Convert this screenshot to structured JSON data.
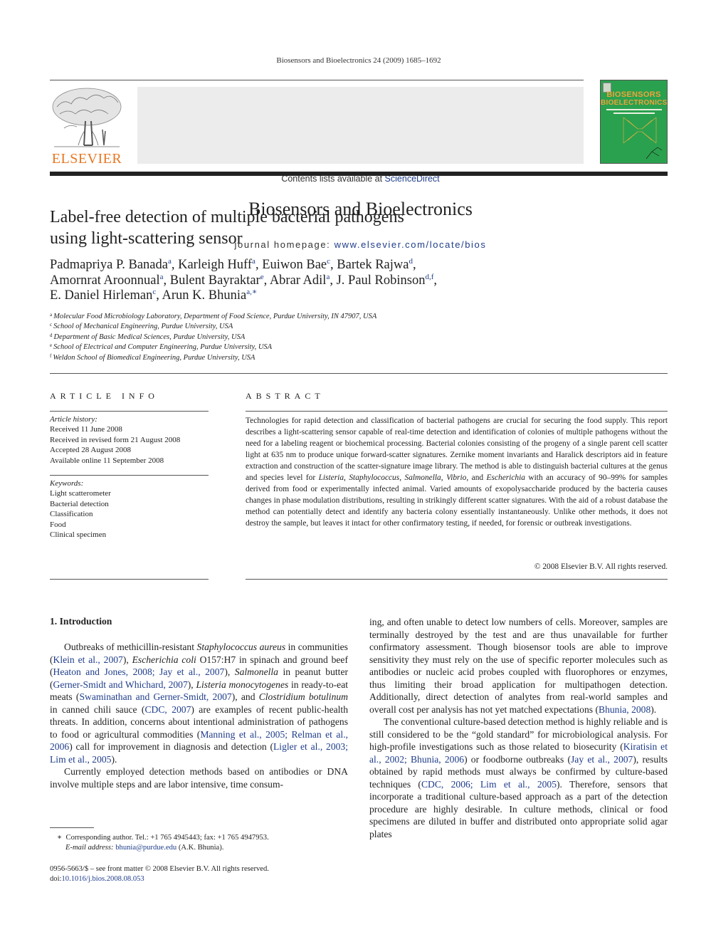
{
  "running_head": "Biosensors and Bioelectronics 24 (2009) 1685–1692",
  "banner": {
    "contents_prefix": "Contents lists available at ",
    "contents_link": "ScienceDirect",
    "journal_title": "Biosensors and Bioelectronics",
    "homepage_prefix": "journal homepage: ",
    "homepage_link": "www.elsevier.com/locate/bios"
  },
  "publisher": {
    "name": "ELSEVIER",
    "logo_color": "#e87722"
  },
  "cover": {
    "line1": "BIOSENSORS",
    "line2": "BIOELECTRONICS",
    "bg_color": "#2aa14e",
    "title_color": "#f0a23a"
  },
  "article": {
    "title_line1": "Label-free detection of multiple bacterial pathogens",
    "title_line2": "using light-scattering sensor",
    "authors": [
      {
        "name": "Padmapriya P. Banada",
        "aff": "a"
      },
      {
        "name": "Karleigh Huff",
        "aff": "a"
      },
      {
        "name": "Euiwon Bae",
        "aff": "c"
      },
      {
        "name": "Bartek Rajwa",
        "aff": "d"
      },
      {
        "name": "Amornrat Aroonnual",
        "aff": "a"
      },
      {
        "name": "Bulent Bayraktar",
        "aff": "e"
      },
      {
        "name": "Abrar Adil",
        "aff": "a"
      },
      {
        "name": "J. Paul Robinson",
        "aff": "d,f"
      },
      {
        "name": "E. Daniel Hirleman",
        "aff": "c"
      },
      {
        "name": "Arun K. Bhunia",
        "aff": "a,∗"
      }
    ],
    "affiliations": [
      {
        "key": "a",
        "text": "Molecular Food Microbiology Laboratory, Department of Food Science, Purdue University, IN 47907, USA"
      },
      {
        "key": "c",
        "text": "School of Mechanical Engineering, Purdue University, USA"
      },
      {
        "key": "d",
        "text": "Department of Basic Medical Sciences, Purdue University, USA"
      },
      {
        "key": "e",
        "text": "School of Electrical and Computer Engineering, Purdue University, USA"
      },
      {
        "key": "f",
        "text": "Weldon School of Biomedical Engineering, Purdue University, USA"
      }
    ]
  },
  "article_info": {
    "heading": "ARTICLE INFO",
    "history_label": "Article history:",
    "history": [
      "Received 11 June 2008",
      "Received in revised form 21 August 2008",
      "Accepted 28 August 2008",
      "Available online 11 September 2008"
    ],
    "keywords_label": "Keywords:",
    "keywords": [
      "Light scatterometer",
      "Bacterial detection",
      "Classification",
      "Food",
      "Clinical specimen"
    ]
  },
  "abstract": {
    "heading": "ABSTRACT",
    "p1": "Technologies for rapid detection and classification of bacterial pathogens are crucial for securing the food supply. This report describes a light-scattering sensor capable of real-time detection and identification of colonies of multiple pathogens without the need for a labeling reagent or biochemical processing. Bacterial colonies consisting of the progeny of a single parent cell scatter light at 635 nm to produce unique forward-scatter signatures. Zernike moment invariants and Haralick descriptors aid in feature extraction and construction of the scatter-signature image library. The method is able to distinguish bacterial cultures at the genus and species level for ",
    "genus1": "Listeria",
    "genus2": "Staphylococcus",
    "genus3": "Salmonella",
    "genus4": "Vibrio",
    "genus5": "Escherichia",
    "p2": " with an accuracy of 90–99% for samples derived from food or experimentally infected animal. Varied amounts of exopolysaccharide produced by the bacteria causes changes in phase modulation distributions, resulting in strikingly different scatter signatures. With the aid of a robust database the method can potentially detect and identify any bacteria colony essentially instantaneously. Unlike other methods, it does not destroy the sample, but leaves it intact for other confirmatory testing, if needed, for forensic or outbreak investigations.",
    "copyright": "© 2008 Elsevier B.V. All rights reserved."
  },
  "intro": {
    "heading": "1.  Introduction",
    "left": {
      "t1": "Outbreaks of methicillin-resistant ",
      "i1": "Staphylococcus aureus",
      "t2": " in communities (",
      "r1": "Klein et al., 2007",
      "t3": "), ",
      "i2": "Escherichia coli",
      "t4": " O157:H7 in spinach and ground beef (",
      "r2": "Heaton and Jones, 2008; Jay et al., 2007",
      "t5": "), ",
      "i3": "Salmonella",
      "t6": " in peanut butter (",
      "r3": "Gerner-Smidt and Whichard, 2007",
      "t7": "), ",
      "i4": "Listeria monocytogenes",
      "t8": " in ready-to-eat meats (",
      "r4": "Swaminathan and Gerner-Smidt, 2007",
      "t9": "), and ",
      "i5": "Clostridium botulinum",
      "t10": " in canned chili sauce (",
      "r5": "CDC, 2007",
      "t11": ") are examples of recent public-health threats. In addition, concerns about intentional administration of pathogens to food or agricultural commodities (",
      "r6": "Manning et al., 2005; Relman et al., 2006",
      "t12": ") call for improvement in diagnosis and detection (",
      "r7": "Ligler et al., 2003; Lim et al., 2005",
      "t13": ").",
      "p2": "Currently employed detection methods based on antibodies or DNA involve multiple steps and are labor intensive, time consum-"
    },
    "right": {
      "p1a": "ing, and often unable to detect low numbers of cells. Moreover, samples are terminally destroyed by the test and are thus unavailable for further confirmatory assessment. Though biosensor tools are able to improve sensitivity they must rely on the use of specific reporter molecules such as antibodies or nucleic acid probes coupled with fluorophores or enzymes, thus limiting their broad application for multipathogen detection. Additionally, direct detection of analytes from real-world samples and overall cost per analysis has not yet matched expectations (",
      "r1": "Bhunia, 2008",
      "p1b": ").",
      "p2a": "The conventional culture-based detection method is highly reliable and is still considered to be the “gold standard” for microbiological analysis. For high-profile investigations such as those related to biosecurity (",
      "r2": "Kiratisin et al., 2002; Bhunia, 2006",
      "p2b": ") or foodborne outbreaks (",
      "r3": "Jay et al., 2007",
      "p2c": "), results obtained by rapid methods must always be confirmed by culture-based techniques (",
      "r4": "CDC, 2006; Lim et al., 2005",
      "p2d": "). Therefore, sensors that incorporate a traditional culture-based approach as a part of the detection procedure are highly desirable. In culture methods, clinical or food specimens are diluted in buffer and distributed onto appropriate solid agar plates"
    }
  },
  "footnote": {
    "star": "∗",
    "corresponding": "Corresponding author. Tel.: +1 765 4945443; fax: +1 765 4947953.",
    "email_label": "E-mail address:",
    "email": "bhunia@purdue.edu",
    "email_suffix": " (A.K. Bhunia).",
    "front_matter": "0956-5663/$ – see front matter © 2008 Elsevier B.V. All rights reserved.",
    "doi_label": "doi:",
    "doi": "10.1016/j.bios.2008.08.053"
  }
}
